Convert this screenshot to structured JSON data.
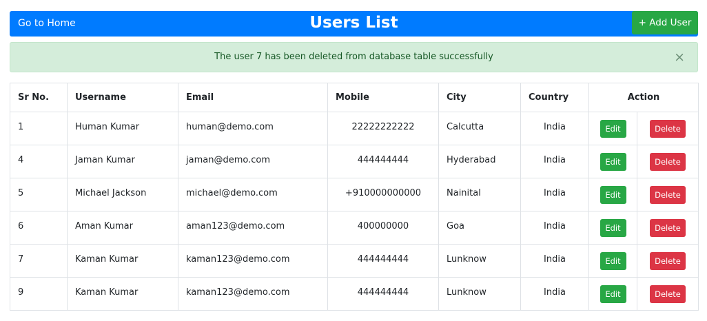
{
  "header": {
    "home_label": "Go to Home",
    "title": "Users List",
    "add_label": "+ Add User"
  },
  "alert": {
    "message": "The user 7 has been deleted from database table successfully",
    "close_glyph": "×"
  },
  "table": {
    "columns": [
      "Sr No.",
      "Username",
      "Email",
      "Mobile",
      "City",
      "Country",
      "Action"
    ],
    "rows": [
      {
        "sr": "1",
        "username": "Human Kumar",
        "email": "human@demo.com",
        "mobile": "22222222222",
        "city": "Calcutta",
        "country": "India"
      },
      {
        "sr": "4",
        "username": "Jaman Kumar",
        "email": "jaman@demo.com",
        "mobile": "444444444",
        "city": "Hyderabad",
        "country": "India"
      },
      {
        "sr": "5",
        "username": "Michael Jackson",
        "email": "michael@demo.com",
        "mobile": "+910000000000",
        "city": "Nainital",
        "country": "India"
      },
      {
        "sr": "6",
        "username": "Aman Kumar",
        "email": "aman123@demo.com",
        "mobile": "400000000",
        "city": "Goa",
        "country": "India"
      },
      {
        "sr": "7",
        "username": "Kaman Kumar",
        "email": "kaman123@demo.com",
        "mobile": "444444444",
        "city": "Lunknow",
        "country": "India"
      },
      {
        "sr": "9",
        "username": "Kaman Kumar",
        "email": "kaman123@demo.com",
        "mobile": "444444444",
        "city": "Lunknow",
        "country": "India"
      }
    ],
    "edit_label": "Edit",
    "delete_label": "Delete"
  },
  "colors": {
    "primary": "#007bff",
    "success": "#28a745",
    "danger": "#dc3545",
    "alert_bg": "#d4edda",
    "alert_text": "#155724"
  }
}
